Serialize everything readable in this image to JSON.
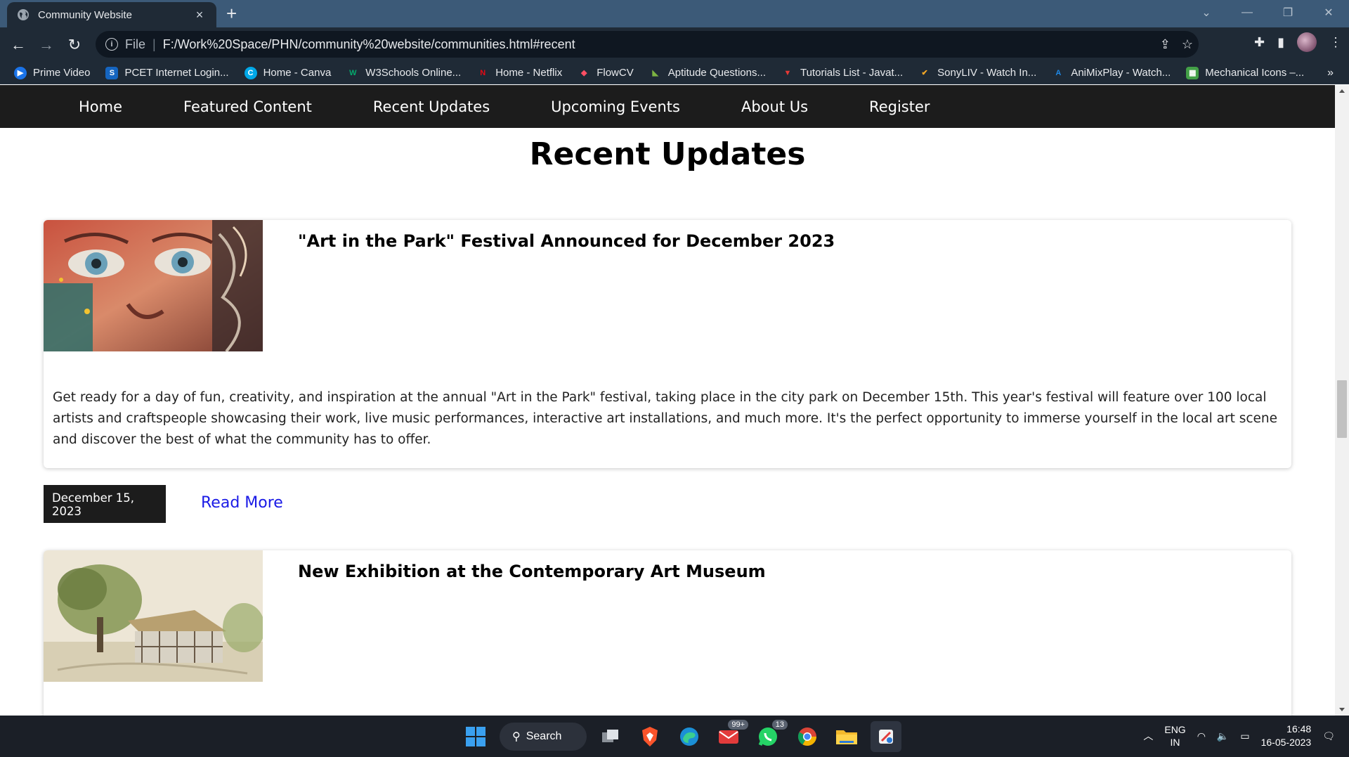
{
  "browser": {
    "tab_title": "Community Website",
    "tab_close": "×",
    "new_tab": "+",
    "url_scheme": "File",
    "url": "F:/Work%20Space/PHN/community%20website/communities.html#recent",
    "bookmarks": [
      {
        "label": "Prime Video",
        "color": "#1a73e8",
        "glyph": "▶"
      },
      {
        "label": "PCET Internet Login...",
        "color": "#1565c0",
        "glyph": "S"
      },
      {
        "label": "Home - Canva",
        "color": "#00c4cc",
        "glyph": "C"
      },
      {
        "label": "W3Schools Online...",
        "color": "#04aa6d",
        "glyph": "W"
      },
      {
        "label": "Home - Netflix",
        "color": "#e50914",
        "glyph": "N"
      },
      {
        "label": "FlowCV",
        "color": "#ff4f64",
        "glyph": "◆"
      },
      {
        "label": "Aptitude Questions...",
        "color": "#7cb342",
        "glyph": "◣"
      },
      {
        "label": "Tutorials List - Javat...",
        "color": "#e53935",
        "glyph": "▼"
      },
      {
        "label": "SonyLIV - Watch In...",
        "color": "#f9a825",
        "glyph": "✔"
      },
      {
        "label": "AniMixPlay - Watch...",
        "color": "#1e88e5",
        "glyph": "A"
      },
      {
        "label": "Mechanical Icons –...",
        "color": "#43a047",
        "glyph": "▦"
      }
    ],
    "bookmarks_more": "»"
  },
  "site": {
    "nav": [
      "Home",
      "Featured Content",
      "Recent Updates",
      "Upcoming Events",
      "About Us",
      "Register"
    ],
    "section_title": "Recent Updates",
    "cards": [
      {
        "title": "\"Art in the Park\" Festival Announced for December 2023",
        "body": "Get ready for a day of fun, creativity, and inspiration at the annual \"Art in the Park\" festival, taking place in the city park on December 15th. This year's festival will feature over 100 local artists and craftspeople showcasing their work, live music performances, interactive art installations, and much more. It's the perfect opportunity to immerse yourself in the local art scene and discover the best of what the community has to offer.",
        "date": "December 15, 2023",
        "read_more": "Read More"
      },
      {
        "title": "New Exhibition at the Contemporary Art Museum"
      }
    ]
  },
  "taskbar": {
    "search_label": "Search",
    "mail_badge": "99+",
    "whatsapp_badge": "13",
    "lang_top": "ENG",
    "lang_bottom": "IN",
    "time": "16:48",
    "date": "16-05-2023"
  }
}
